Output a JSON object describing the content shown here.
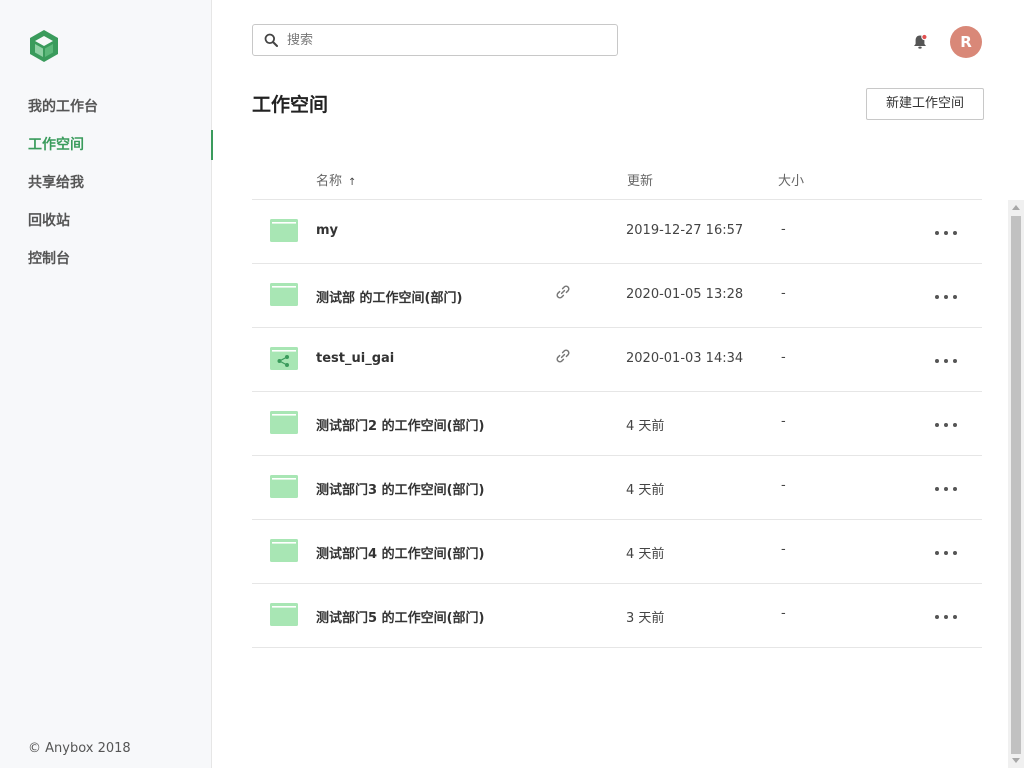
{
  "app": {
    "logo_icon": "cube-logo-icon",
    "copyright": "© Anybox 2018",
    "accent_color": "#3a9b5c"
  },
  "sidebar": {
    "items": [
      {
        "label": "我的工作台",
        "active": false
      },
      {
        "label": "工作空间",
        "active": true
      },
      {
        "label": "共享给我",
        "active": false
      },
      {
        "label": "回收站",
        "active": false
      },
      {
        "label": "控制台",
        "active": false
      }
    ]
  },
  "header": {
    "search_placeholder": "搜索",
    "search_value": "",
    "search_icon": "search-icon",
    "bell_icon": "bell-icon",
    "avatar_initial": "R",
    "avatar_color": "#d98878"
  },
  "main": {
    "title": "工作空间",
    "new_button_label": "新建工作空间",
    "columns": {
      "name": "名称",
      "sort_indicator": "↑",
      "updated": "更新",
      "size": "大小"
    },
    "rows": [
      {
        "name": "my",
        "updated": "2019-12-27 16:57",
        "size": "-",
        "icon": "folder-icon",
        "linked": false
      },
      {
        "name": "测试部 的工作空间(部门)",
        "updated": "2020-01-05 13:28",
        "size": "-",
        "icon": "folder-icon",
        "linked": true
      },
      {
        "name": "test_ui_gai",
        "updated": "2020-01-03 14:34",
        "size": "-",
        "icon": "shared-folder-icon",
        "linked": true
      },
      {
        "name": "测试部门2 的工作空间(部门)",
        "updated": "4 天前",
        "size": "-",
        "icon": "folder-icon",
        "linked": false
      },
      {
        "name": "测试部门3 的工作空间(部门)",
        "updated": "4 天前",
        "size": "-",
        "icon": "folder-icon",
        "linked": false
      },
      {
        "name": "测试部门4 的工作空间(部门)",
        "updated": "4 天前",
        "size": "-",
        "icon": "folder-icon",
        "linked": false
      },
      {
        "name": "测试部门5 的工作空间(部门)",
        "updated": "3 天前",
        "size": "-",
        "icon": "folder-icon",
        "linked": false
      }
    ]
  }
}
